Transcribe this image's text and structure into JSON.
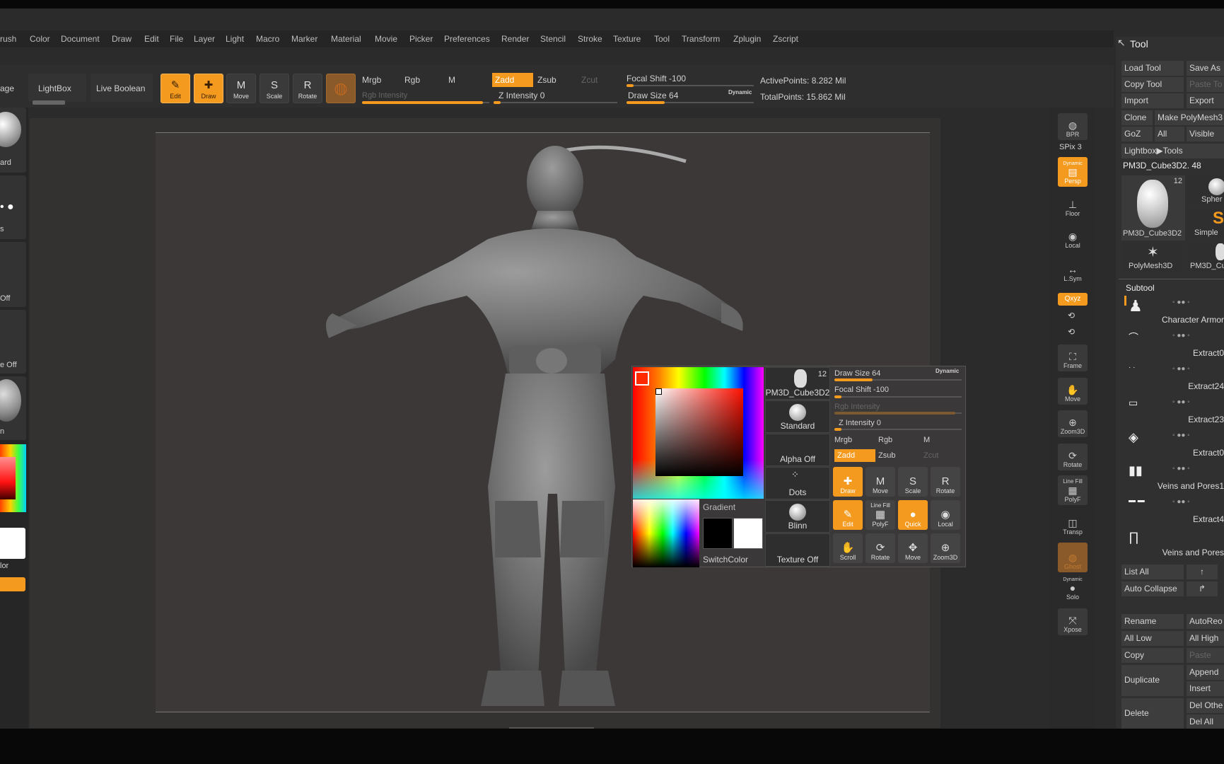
{
  "menu": [
    "rush",
    "Color",
    "Document",
    "Draw",
    "Edit",
    "File",
    "Layer",
    "Light",
    "Macro",
    "Marker",
    "Material",
    "Movie",
    "Picker",
    "Preferences",
    "Render",
    "Stencil",
    "Stroke",
    "Texture",
    "Tool",
    "Transform",
    "Zplugin",
    "Zscript"
  ],
  "toolbar": {
    "age": "age",
    "lightbox": "LightBox",
    "live_boolean": "Live Boolean",
    "edit": "Edit",
    "draw": "Draw",
    "move": "Move",
    "scale": "Scale",
    "rotate": "Rotate",
    "mrgb": "Mrgb",
    "rgb": "Rgb",
    "m": "M",
    "zadd": "Zadd",
    "zsub": "Zsub",
    "zcut": "Zcut",
    "rgb_intensity": "Rgb Intensity",
    "z_intensity": "Z Intensity 0",
    "focal_shift": "Focal Shift -100",
    "draw_size": "Draw Size 64",
    "dynamic": "Dynamic",
    "active_points": "ActivePoints: 8.282 Mil",
    "total_points": "TotalPoints: 15.862 Mil"
  },
  "left_shelf": {
    "standard": "ard",
    "dots": "s",
    "alpha_off": "Off",
    "texture_off": "e Off",
    "material": "n",
    "switch_color": "lor"
  },
  "right_shelf": {
    "bpr": "BPR",
    "spix": "SPix 3",
    "dynamic": "Dynamic",
    "persp": "Persp",
    "floor": "Floor",
    "local": "Local",
    "lsym": "L.Sym",
    "xyz": "Qxyz",
    "frame": "Frame",
    "move": "Move",
    "zoom3d": "Zoom3D",
    "rotate": "Rotate",
    "line_fill": "Line Fill",
    "polyf": "PolyF",
    "transp": "Transp",
    "ghost": "Ghost",
    "dynamic2": "Dynamic",
    "solo": "Solo",
    "xpose": "Xpose"
  },
  "tool_panel": {
    "title": "Tool",
    "load_tool": "Load Tool",
    "save_as": "Save As",
    "copy_tool": "Copy Tool",
    "paste_tool": "Paste To",
    "import": "Import",
    "export": "Export",
    "clone": "Clone",
    "make_polymesh": "Make PolyMesh3",
    "goz": "GoZ",
    "all": "All",
    "visible": "Visible",
    "lightbox_tools": "Lightbox▶Tools",
    "current_tool": "PM3D_Cube3D2. 48",
    "thumb_count": "12",
    "thumb1": "PM3D_Cube3D2",
    "thumb2": "Spher",
    "thumb3": "Simple",
    "thumb4": "PolyMesh3D",
    "thumb5": "PM3D_Cu",
    "subtool_title": "Subtool",
    "subtools": [
      "Character Armor",
      "Extract0",
      "Extract24",
      "Extract23",
      "Extract0",
      "Veins and Pores1",
      "Extract4",
      "Veins and Pores"
    ],
    "list_all": "List All",
    "auto_collapse": "Auto Collapse",
    "rename": "Rename",
    "autoreorder": "AutoReo",
    "all_low": "All Low",
    "all_high": "All High",
    "copy": "Copy",
    "paste": "Paste",
    "duplicate": "Duplicate",
    "append": "Append",
    "insert": "Insert",
    "delete": "Delete",
    "del_other": "Del Othe",
    "del_all": "Del All"
  },
  "popup": {
    "brush_count": "12",
    "brush_name": "PM3D_Cube3D2",
    "standard": "Standard",
    "alpha_off": "Alpha Off",
    "dots": "Dots",
    "blinn": "Blinn",
    "texture_off": "Texture Off",
    "gradient": "Gradient",
    "switch_color": "SwitchColor",
    "draw_size": "Draw Size 64",
    "dynamic": "Dynamic",
    "focal_shift": "Focal Shift -100",
    "rgb_intensity": "Rgb Intensity",
    "z_intensity": "Z Intensity 0",
    "mrgb": "Mrgb",
    "rgb": "Rgb",
    "m": "M",
    "zadd": "Zadd",
    "zsub": "Zsub",
    "zcut": "Zcut",
    "draw": "Draw",
    "move": "Move",
    "scale": "Scale",
    "rotate": "Rotate",
    "edit": "Edit",
    "line_fill": "Line Fill",
    "polyf": "PolyF",
    "quick": "Quick",
    "local": "Local",
    "scroll": "Scroll",
    "rotate2": "Rotate",
    "move2": "Move",
    "zoom3d": "Zoom3D"
  },
  "colors": {
    "accent": "#f39a1f",
    "background": "#2b2b2b",
    "primary_color": "#ff2a00",
    "secondary_color": "#ffffff"
  },
  "slider_levels": {
    "z_intensity": 0.0,
    "focal_shift": 0.0,
    "draw_size": 0.3,
    "rgb_intensity": 0.95
  }
}
